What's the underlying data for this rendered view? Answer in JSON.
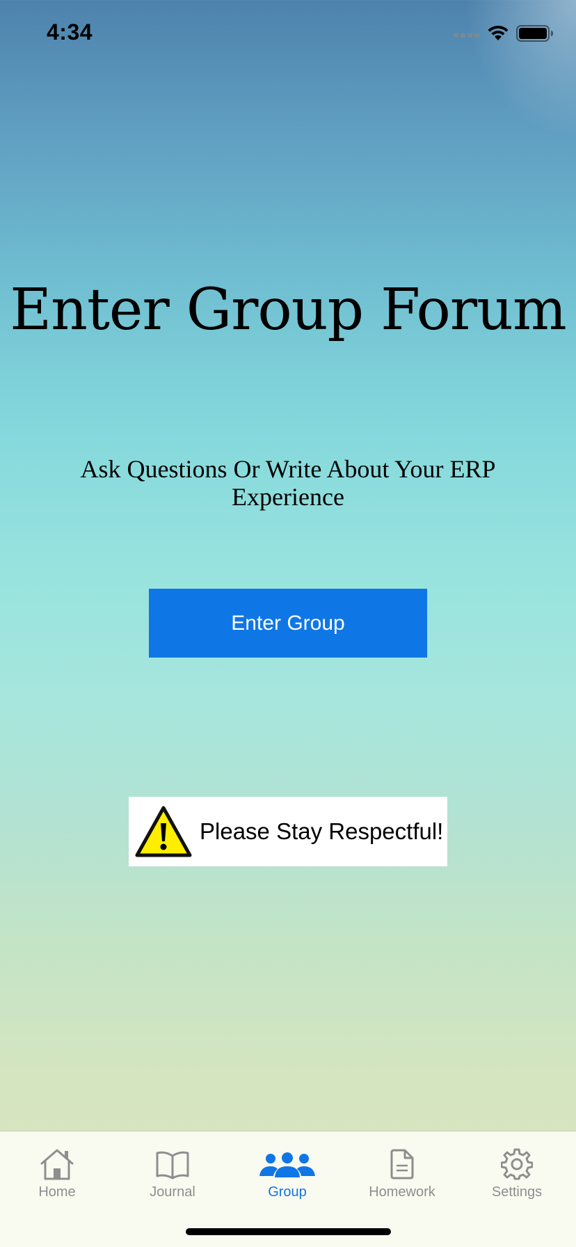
{
  "status_bar": {
    "time": "4:34"
  },
  "main": {
    "title": "Enter Group Forum",
    "subtitle": "Ask Questions Or Write About Your ERP Experience",
    "enter_button_label": "Enter Group",
    "warning_text": "Please Stay Respectful!"
  },
  "tab_bar": {
    "tabs": [
      {
        "label": "Home",
        "icon": "house-icon",
        "active": false
      },
      {
        "label": "Journal",
        "icon": "book-icon",
        "active": false
      },
      {
        "label": "Group",
        "icon": "people-icon",
        "active": true
      },
      {
        "label": "Homework",
        "icon": "document-icon",
        "active": false
      },
      {
        "label": "Settings",
        "icon": "gear-icon",
        "active": false
      }
    ]
  },
  "colors": {
    "accent": "#0f76e6",
    "inactive_tab": "#8e8e8e",
    "warning_yellow": "#ffee00"
  }
}
